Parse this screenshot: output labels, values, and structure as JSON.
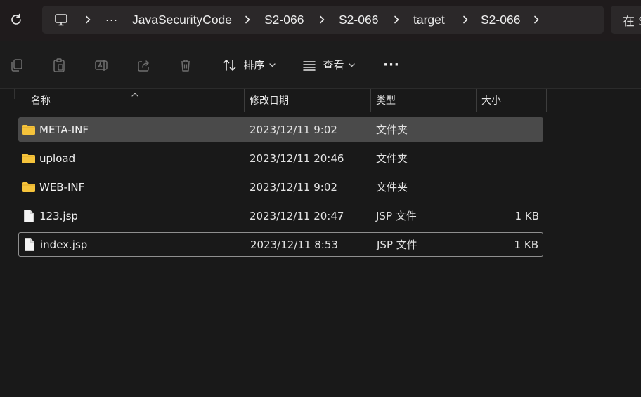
{
  "address_bar": {
    "path_icon": "monitor-icon",
    "overflow_label": "···",
    "crumbs": [
      "JavaSecurityCode",
      "S2-066",
      "S2-066",
      "target",
      "S2-066"
    ],
    "search_placeholder": "在 S"
  },
  "toolbar": {
    "sort_label": "排序",
    "view_label": "查看",
    "more_label": "···"
  },
  "columns": {
    "name": "名称",
    "modified": "修改日期",
    "type": "类型",
    "size": "大小"
  },
  "files": [
    {
      "name": "META-INF",
      "modified": "2023/12/11 9:02",
      "type": "文件夹",
      "size": "",
      "icon": "folder-icon"
    },
    {
      "name": "upload",
      "modified": "2023/12/11 20:46",
      "type": "文件夹",
      "size": "",
      "icon": "folder-icon"
    },
    {
      "name": "WEB-INF",
      "modified": "2023/12/11 9:02",
      "type": "文件夹",
      "size": "",
      "icon": "folder-icon"
    },
    {
      "name": "123.jsp",
      "modified": "2023/12/11 20:47",
      "type": "JSP 文件",
      "size": "1 KB",
      "icon": "file-icon"
    },
    {
      "name": "index.jsp",
      "modified": "2023/12/11 8:53",
      "type": "JSP 文件",
      "size": "1 KB",
      "icon": "file-icon"
    }
  ],
  "colors": {
    "background": "#191919",
    "address_bar": "#1f1b1c",
    "breadcrumb_bg": "#2b2829",
    "selected_row": "#4a4a4a",
    "folder": "#f5c33b"
  }
}
